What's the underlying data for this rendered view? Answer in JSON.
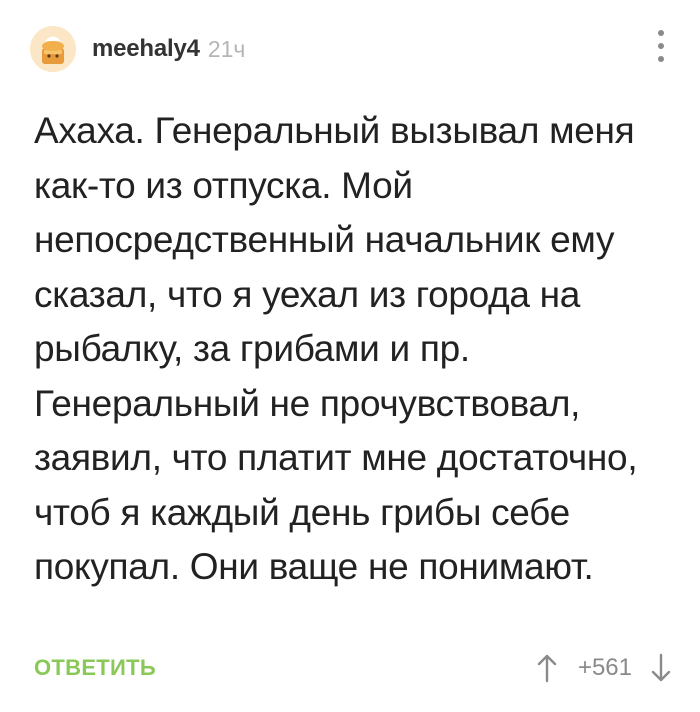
{
  "comment": {
    "author": "meehaly4",
    "time": "21ч",
    "text": "Ахаха. Генеральный вызывал меня как-то из отпуска. Мой непосредственный начальник ему сказал, что я уехал из города на рыбалку, за грибами и пр. Генеральный не прочувствовал, заявил, что платит мне достаточно, чтоб я каждый день грибы себе покупал. Они ваще не понимают.",
    "reply_label": "ОТВЕТИТЬ",
    "score": "+561"
  },
  "icons": {
    "avatar": "cartoon-avatar",
    "menu": "vertical-dots-icon",
    "upvote": "arrow-up-icon",
    "downvote": "arrow-down-icon"
  },
  "colors": {
    "reply": "#8ac858",
    "muted": "#8a8a8a",
    "time": "#b5b5b5",
    "text": "#222222"
  }
}
